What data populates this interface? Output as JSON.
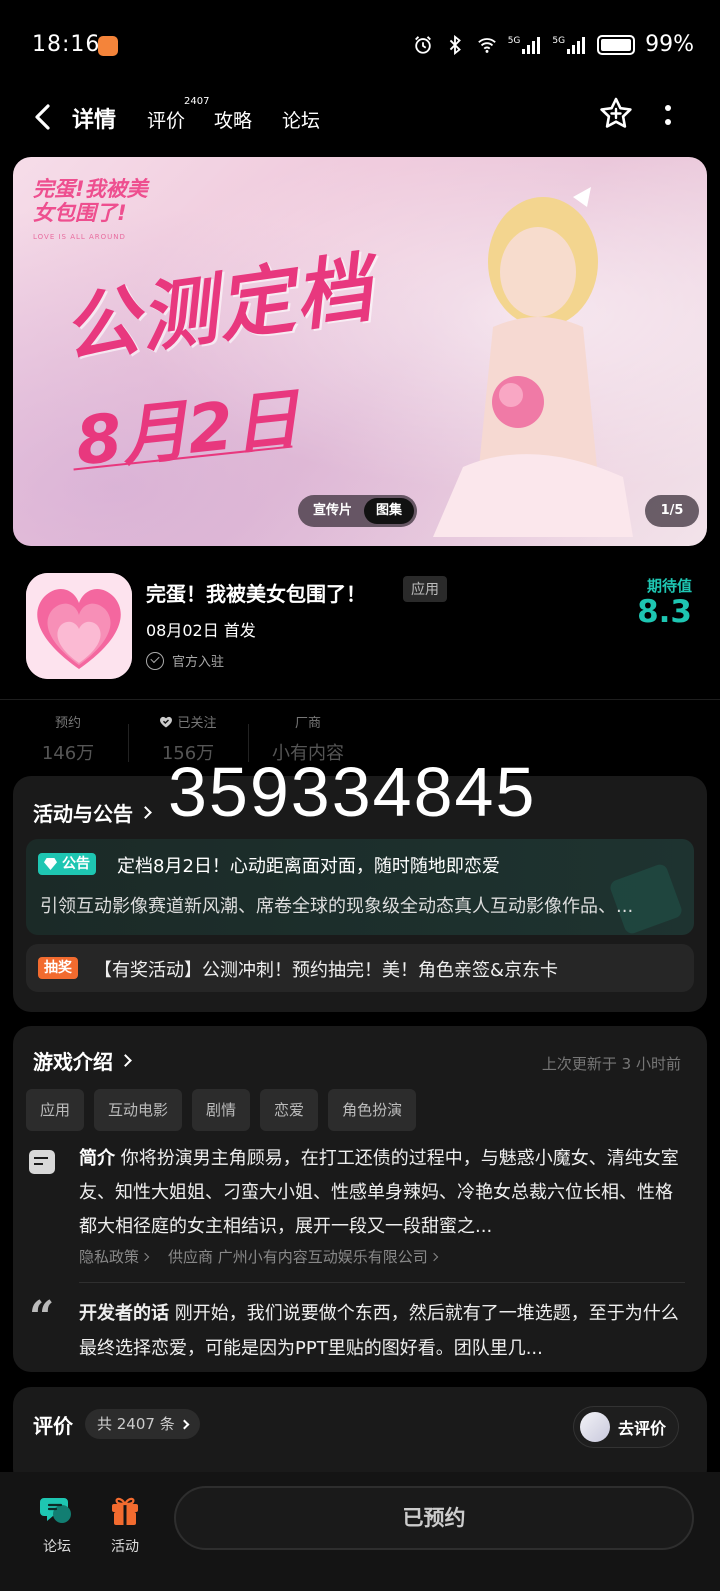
{
  "status_bar": {
    "time": "18:16",
    "battery": "99%",
    "battery_level": 0.99,
    "signal_1_label": "5G",
    "signal_2_label": "5G"
  },
  "header": {
    "tabs": [
      {
        "label": "详情",
        "active": true
      },
      {
        "label": "评价",
        "badge": "2407"
      },
      {
        "label": "攻略"
      },
      {
        "label": "论坛"
      }
    ]
  },
  "banner": {
    "logo_text": "完蛋!我被美女包围了!",
    "logo_subtitle": "LOVE IS ALL AROUND",
    "headline": "公测定档",
    "date_text": "8月2日",
    "switch": {
      "video": "宣传片",
      "gallery": "图集"
    },
    "counter": "1/5"
  },
  "app": {
    "title": "完蛋！我被美女包围了！",
    "type_tag": "应用",
    "release": "08月02日 首发",
    "official": "官方入驻",
    "expectation_label": "期待值",
    "expectation_value": "8.3"
  },
  "stats": {
    "reservations": {
      "label": "预约",
      "value": "146万"
    },
    "followers": {
      "label": "已关注",
      "value": "156万"
    },
    "vendor": {
      "label": "厂商",
      "value": "小有内容"
    }
  },
  "overlay_number": "359334845",
  "activities": {
    "title": "活动与公告",
    "notice": {
      "tag": "公告",
      "title": "定档8月2日！心动距离面对面，随时随地即恋爱",
      "body": "引领互动影像赛道新风潮、席卷全球的现象级全动态真人互动影像作品、..."
    },
    "lottery": {
      "tag": "抽奖",
      "text": "【有奖活动】公测冲刺！预约抽完！美！角色亲签&京东卡"
    }
  },
  "intro": {
    "title": "游戏介绍",
    "updated": "上次更新于 3 小时前",
    "tags": [
      "应用",
      "互动电影",
      "剧情",
      "恋爱",
      "角色扮演"
    ],
    "summary_label": "简介",
    "summary": "你将扮演男主角顾易，在打工还债的过程中，与魅惑小魔女、清纯女室友、知性大姐姐、刁蛮大小姐、性感单身辣妈、冷艳女总裁六位长相、性格都大相径庭的女主相结识，展开一段又一段甜蜜之...",
    "privacy_link": "隐私政策",
    "supplier_link": "供应商 广州小有内容互动娱乐有限公司",
    "dev_label": "开发者的话",
    "dev_words": "刚开始，我们说要做个东西，然后就有了一堆选题，至于为什么最终选择恋爱，可能是因为PPT里贴的图好看。团队里几..."
  },
  "reviews": {
    "title": "评价",
    "count": "共 2407 条",
    "go_review": "去评价"
  },
  "bottom_bar": {
    "forum": "论坛",
    "activity": "活动",
    "reserve_button": "已预约"
  },
  "colors": {
    "accent": "#1ec6b2",
    "lottery": "#f26b2f",
    "banner_pink": "#e8387e",
    "gift_orange": "#f26b2f"
  }
}
